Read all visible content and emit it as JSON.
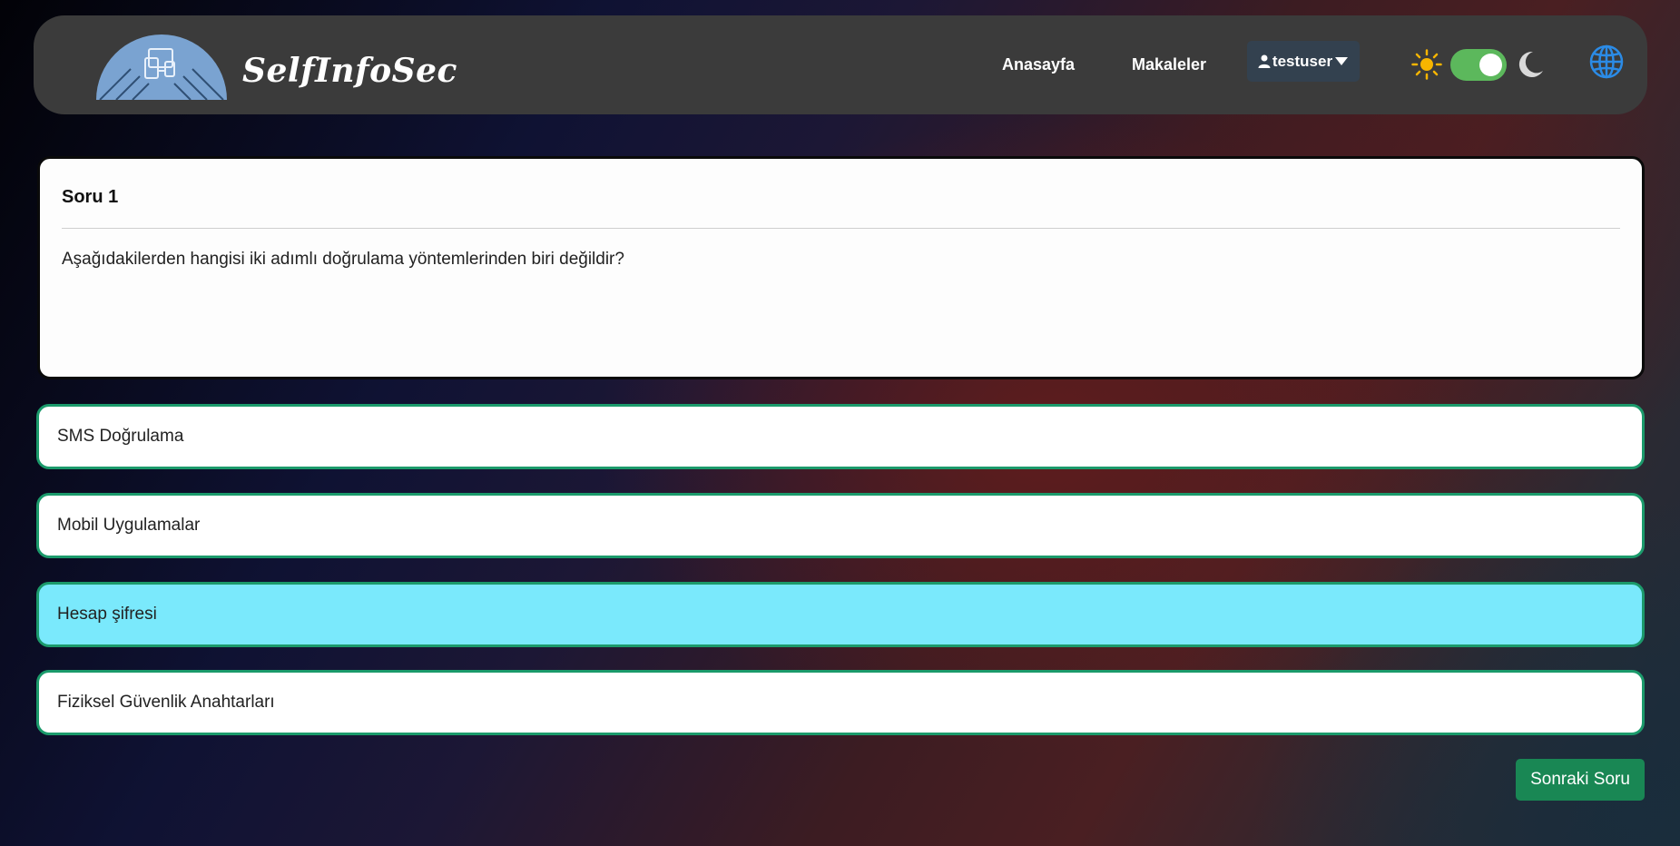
{
  "navbar": {
    "brand": "SelfInfoSec",
    "links": [
      {
        "label": "Anasayfa"
      },
      {
        "label": "Makaleler"
      }
    ],
    "user": {
      "username": "testuser",
      "icon": "user-icon",
      "caret": "caret-down-icon"
    },
    "theme_toggle": {
      "sun_icon": "sun-icon",
      "moon_icon": "moon-icon",
      "state": "on",
      "color": "#5cb85c"
    },
    "language_icon": "globe-icon",
    "colors": {
      "background": "#3b3b3b",
      "user_button": "#33414f"
    }
  },
  "question": {
    "title": "Soru 1",
    "text": "Aşağıdakilerden hangisi iki adımlı doğrulama yöntemlerinden biri değildir?"
  },
  "options": [
    {
      "label": "SMS Doğrulama",
      "selected": false
    },
    {
      "label": "Mobil Uygulamalar",
      "selected": false
    },
    {
      "label": "Hesap şifresi",
      "selected": true
    },
    {
      "label": "Fiziksel Güvenlik Anahtarları",
      "selected": false
    }
  ],
  "colors": {
    "option_border": "#1b9a6b",
    "option_selected": "#7ae9fc",
    "next_button": "#198754"
  },
  "next_button": {
    "label": "Sonraki Soru"
  }
}
